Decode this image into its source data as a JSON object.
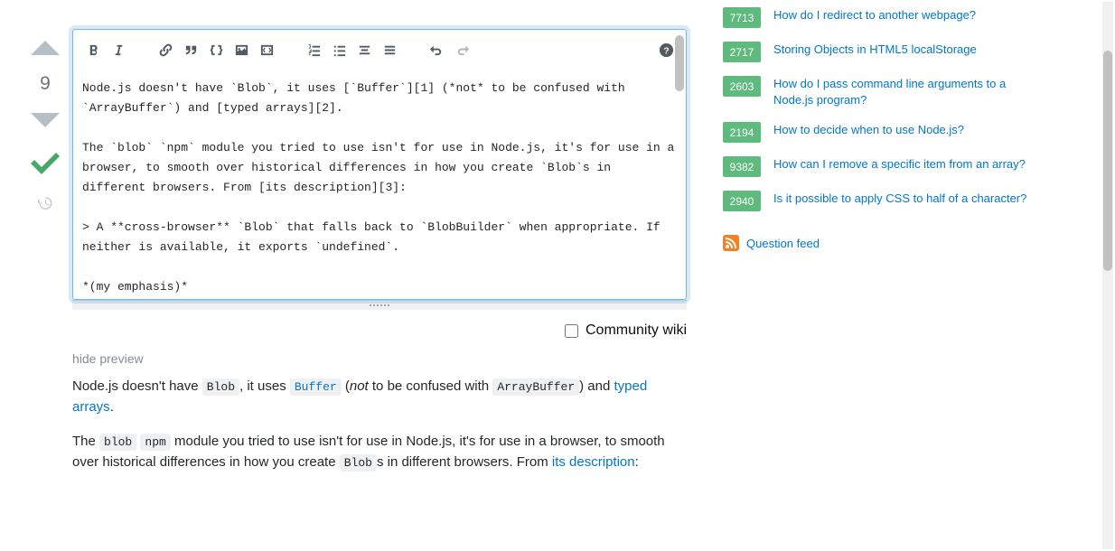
{
  "vote": {
    "score": "9"
  },
  "editor": {
    "content": "Node.js doesn't have `Blob`, it uses [`Buffer`][1] (*not* to be confused with `ArrayBuffer`) and [typed arrays][2].\n\nThe `blob` `npm` module you tried to use isn't for use in Node.js, it's for use in a browser, to smooth over historical differences in how you create `Blob`s in different browsers. From [its description][3]:\n\n> A **cross-browser** `Blob` that falls back to `BlobBuilder` when appropriate. If neither is available, it exports `undefined`.\n\n*(my emphasis)*"
  },
  "community": {
    "label": "Community wiki"
  },
  "preview": {
    "hide_label": "hide preview",
    "p1_a": "Node.js doesn't have ",
    "p1_code1": "Blob",
    "p1_b": ", it uses ",
    "p1_code2": "Buffer",
    "p1_c": " (",
    "p1_em": "not",
    "p1_d": " to be confused with ",
    "p1_code3": "ArrayBuffer",
    "p1_e": ") and ",
    "p1_link": "typed arrays",
    "p1_f": ".",
    "p2_a": "The ",
    "p2_code1": "blob",
    "p2_space": " ",
    "p2_code2": "npm",
    "p2_b": " module you tried to use isn't for use in Node.js, it's for use in a browser, to smooth over historical differences in how you create ",
    "p2_code3": "Blob",
    "p2_c": "s in different browsers. From ",
    "p2_link": "its description",
    "p2_d": ":"
  },
  "related": [
    {
      "score": "7713",
      "title": "How do I redirect to another webpage?"
    },
    {
      "score": "2717",
      "title": "Storing Objects in HTML5 localStorage"
    },
    {
      "score": "2603",
      "title": "How do I pass command line arguments to a Node.js program?"
    },
    {
      "score": "2194",
      "title": "How to decide when to use Node.js?"
    },
    {
      "score": "9382",
      "title": "How can I remove a specific item from an array?"
    },
    {
      "score": "2940",
      "title": "Is it possible to apply CSS to half of a character?"
    }
  ],
  "feed": {
    "label": "Question feed"
  }
}
